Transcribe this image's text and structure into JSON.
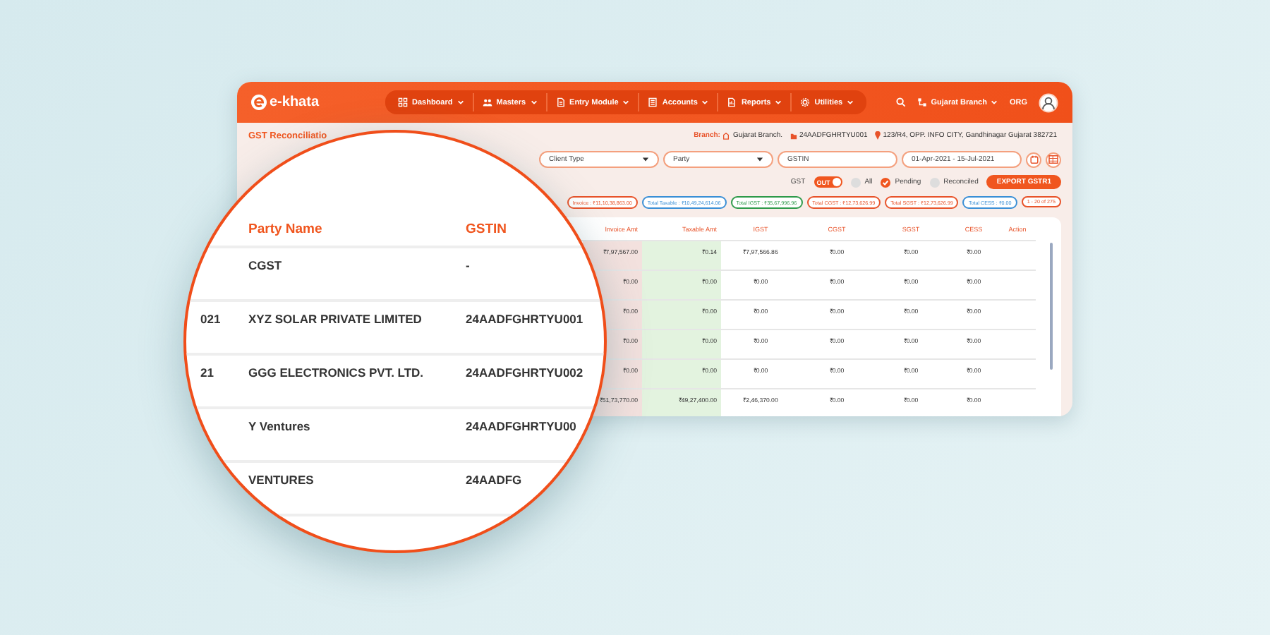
{
  "app": {
    "logo": "e-khata"
  },
  "nav": {
    "menu": [
      {
        "label": "Dashboard"
      },
      {
        "label": "Masters"
      },
      {
        "label": "Entry Module"
      },
      {
        "label": "Accounts"
      },
      {
        "label": "Reports"
      },
      {
        "label": "Utilities"
      }
    ],
    "branch": "Gujarat Branch",
    "org": "ORG"
  },
  "page": {
    "title": "GST Reconciliatio",
    "branch_label": "Branch:",
    "branch_name": "Gujarat Branch.",
    "branch_gstin": "24AADFGHRTYU001",
    "branch_address": "123/R4, OPP. INFO CITY, Gandhinagar Gujarat 382721"
  },
  "filters": [
    {
      "kind": "select",
      "placeholder": "Client Type"
    },
    {
      "kind": "select",
      "placeholder": "Party"
    },
    {
      "kind": "input",
      "placeholder": "GSTIN"
    },
    {
      "kind": "input",
      "value": "01-Apr-2021 - 15-Jul-2021"
    }
  ],
  "gst_toggle": {
    "label": "GST",
    "value": "OUT",
    "on": true
  },
  "status_options": [
    {
      "label": "All",
      "selected": false
    },
    {
      "label": "Pending",
      "selected": true
    },
    {
      "label": "Reconciled",
      "selected": false
    }
  ],
  "export_button": "EXPORT GSTR1",
  "totals": [
    {
      "text": "Invoice : ₹11,10,38,863.00",
      "color": "#e8532a"
    },
    {
      "text": "Total Taxable : ₹10,49,24,614.06",
      "color": "#3a8fd6"
    },
    {
      "text": "Total IGST : ₹35,67,996.96",
      "color": "#2e9a4a"
    },
    {
      "text": "Total CGST : ₹12,73,626.99",
      "color": "#e8532a"
    },
    {
      "text": "Total SGST : ₹12,73,626.99",
      "color": "#e8532a"
    },
    {
      "text": "Total CESS : ₹0.00",
      "color": "#3a8fd6"
    },
    {
      "text": "1 - 20 of 275",
      "color": "#e8532a"
    }
  ],
  "table": {
    "columns": [
      "Invoice Amt",
      "Taxable Amt",
      "IGST",
      "CGST",
      "SGST",
      "CESS",
      "Action"
    ],
    "rows": [
      [
        "₹7,97,567.00",
        "₹0.14",
        "₹7,97,566.86",
        "₹0.00",
        "₹0.00",
        "₹0.00"
      ],
      [
        "₹0.00",
        "₹0.00",
        "₹0.00",
        "₹0.00",
        "₹0.00",
        "₹0.00"
      ],
      [
        "₹0.00",
        "₹0.00",
        "₹0.00",
        "₹0.00",
        "₹0.00",
        "₹0.00"
      ],
      [
        "₹0.00",
        "₹0.00",
        "₹0.00",
        "₹0.00",
        "₹0.00",
        "₹0.00"
      ],
      [
        "₹0.00",
        "₹0.00",
        "₹0.00",
        "₹0.00",
        "₹0.00",
        "₹0.00"
      ],
      [
        "₹51,73,770.00",
        "₹49,27,400.00",
        "₹2,46,370.00",
        "₹0.00",
        "₹0.00",
        "₹0.00"
      ]
    ]
  },
  "magnifier": {
    "columns": [
      "Party Name",
      "GSTIN"
    ],
    "rows": [
      {
        "party": "CGST",
        "gstin": "-"
      },
      {
        "column_1": "021",
        "party": "XYZ SOLAR PRIVATE LIMITED",
        "gstin": "24AADFGHRTYU001"
      },
      {
        "column_1": "21",
        "party": "GGG ELECTRONICS PVT. LTD.",
        "gstin": "24AADFGHRTYU002"
      },
      {
        "party": "Y Ventures",
        "gstin": "24AADFGHRTYU00"
      },
      {
        "party": "VENTURES",
        "gstin": "24AADFG"
      }
    ]
  }
}
